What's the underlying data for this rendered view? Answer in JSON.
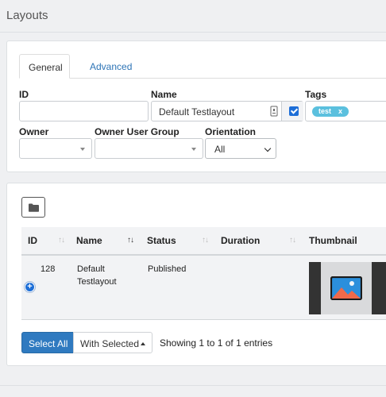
{
  "page": {
    "title": "Layouts"
  },
  "filter": {
    "tabs": [
      {
        "label": "General",
        "active": true
      },
      {
        "label": "Advanced",
        "active": false
      }
    ],
    "fields": {
      "id": {
        "label": "ID",
        "value": ""
      },
      "name": {
        "label": "Name",
        "value": "Default Testlayout",
        "exact_match_checked": true
      },
      "tags": {
        "label": "Tags",
        "tag": "test",
        "remove": "x"
      },
      "owner": {
        "label": "Owner",
        "value": ""
      },
      "owner_group": {
        "label": "Owner User Group",
        "value": ""
      },
      "orientation": {
        "label": "Orientation",
        "value": "All"
      }
    }
  },
  "table": {
    "columns": [
      {
        "label": "ID",
        "sort": "↑↓"
      },
      {
        "label": "Name",
        "sort": "↑↓"
      },
      {
        "label": "Status",
        "sort": "↑↓"
      },
      {
        "label": "Duration",
        "sort": "↑↓"
      },
      {
        "label": "Thumbnail"
      }
    ],
    "rows": [
      {
        "id": "128",
        "name_line1": "Default",
        "name_line2": "Testlayout",
        "status": "Published",
        "duration": "",
        "thumbnail_icon": "image-icon"
      }
    ],
    "expand_symbol": "+"
  },
  "actions": {
    "select_all": "Select All",
    "with_selected": "With Selected",
    "entries_info": "Showing 1 to 1 of 1 entries"
  },
  "colors": {
    "primary": "#2f7ac0",
    "link": "#2d74b6",
    "tag": "#5bc0de",
    "checkbox": "#1d6ed7"
  }
}
